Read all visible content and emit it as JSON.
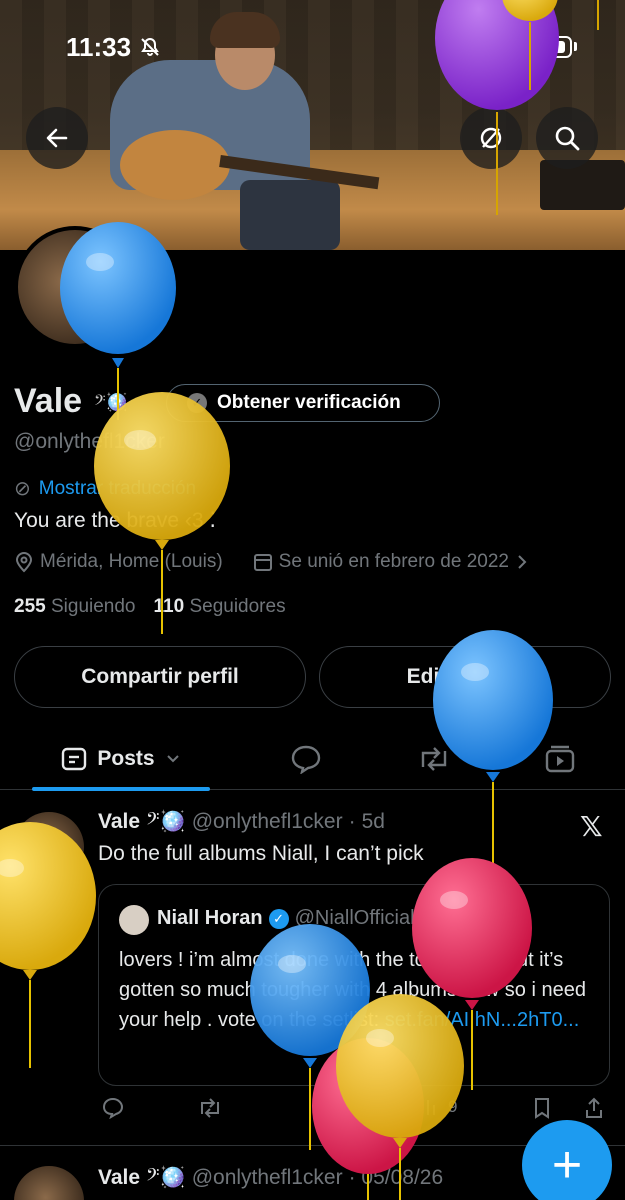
{
  "status_bar": {
    "time": "11:33"
  },
  "profile": {
    "name": "Vale",
    "name_emoji": "𝄢🪩",
    "verify_button": "Obtener verificación",
    "handle": "@onlythefl1cker",
    "translate_link": "Mostrar traducción",
    "bio": "You are the brave ‹3 ⁚",
    "location": "Mérida, Home (Louis)",
    "joined": "Se unió en febrero de 2022",
    "following_count": "255",
    "following_label": "Siguiendo",
    "followers_count": "110",
    "followers_label": "Seguidores",
    "share_button": "Compartir perfil",
    "edit_button": "Editar perfil"
  },
  "tabs": {
    "posts": "Posts"
  },
  "post": {
    "name": "Vale",
    "emoji": "𝄢🪩",
    "handle": "@onlythefl1cker",
    "dot": "·",
    "time": "5d",
    "text": "Do the full albums Niall, I can’t pick",
    "x_logo": "𝕏",
    "quote": {
      "name": "Niall Horan",
      "handle": "@NiallOfficial",
      "time": "5d",
      "text": "lovers ! i’m almost done with the tour setlist but it’s gotten so much tougher with 4 albums now so i need your help . vote on the setlist: ",
      "link": "set.fan/AI.hN...2hT0..."
    },
    "views": "9"
  },
  "post2": {
    "name": "Vale",
    "emoji": "𝄢🪩",
    "handle": "@onlythefl1cker",
    "date": "· 05/08/26"
  },
  "colors": {
    "accent": "#1d9bf0",
    "background": "#000000",
    "muted": "#71767b"
  },
  "icons": [
    "back-arrow-icon",
    "translate-icon",
    "search-icon",
    "location-icon",
    "calendar-icon",
    "chevron-right-icon",
    "reply-icon",
    "repost-icon",
    "like-icon",
    "views-icon",
    "bookmark-icon",
    "share-icon",
    "compose-plus-icon"
  ]
}
